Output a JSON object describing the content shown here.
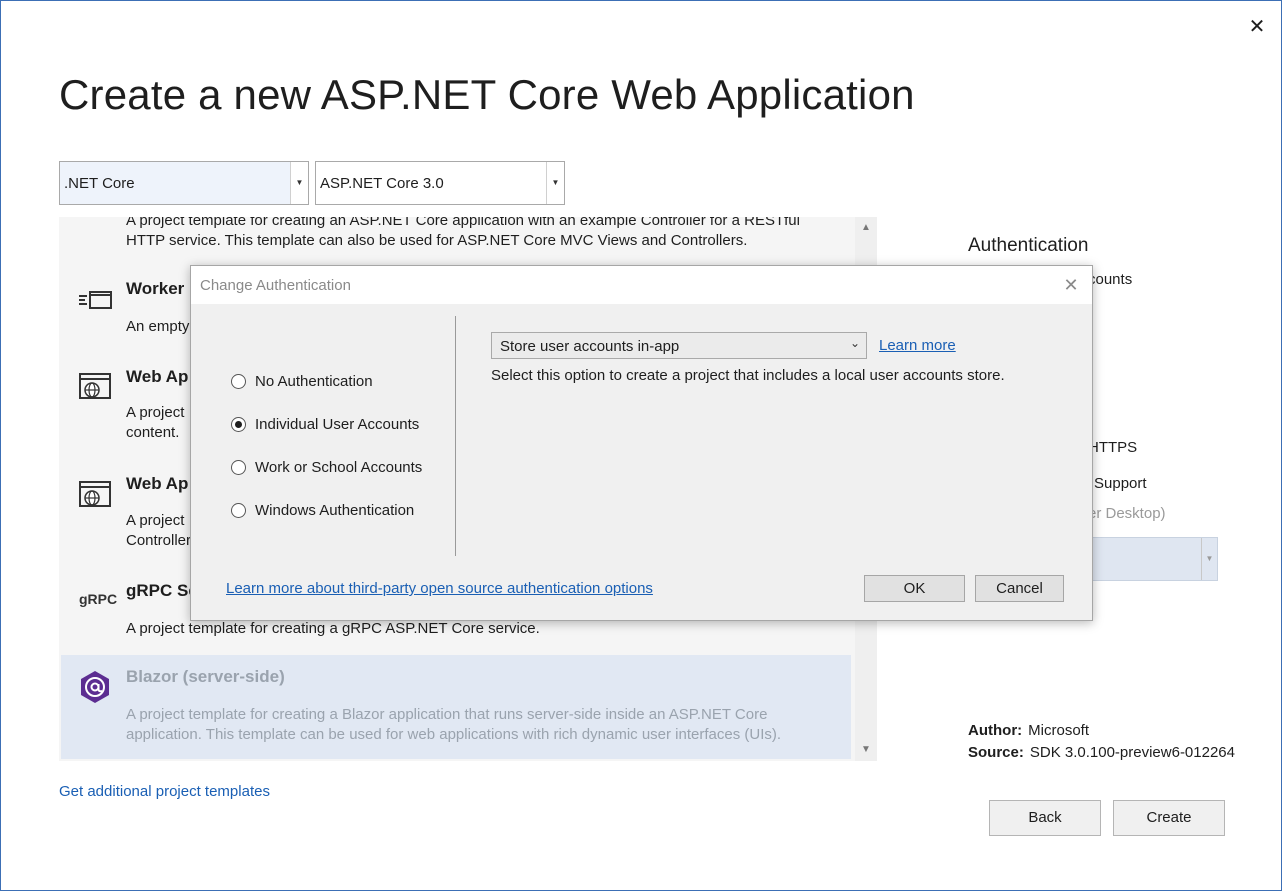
{
  "window": {
    "title": "Create a new ASP.NET Core Web Application",
    "close_glyph": "✕"
  },
  "filters": {
    "framework": ".NET Core",
    "version": "ASP.NET Core 3.0"
  },
  "templates": [
    {
      "name": "",
      "icon": "api-icon",
      "desc": "A project template for creating an ASP.NET Core application with an example Controller for a RESTful HTTP service. This template can also be used for ASP.NET Core MVC Views and Controllers."
    },
    {
      "name": "Worker",
      "icon": "worker-icon",
      "desc": "An empty"
    },
    {
      "name": "Web Ap",
      "icon": "web-app-icon",
      "desc": "A project\ncontent."
    },
    {
      "name": "Web Ap",
      "icon": "web-app-mvc-icon",
      "desc": "A project\nController"
    },
    {
      "name": "gRPC Se",
      "icon": "grpc-icon",
      "icon_text": "gRPC",
      "desc": "A project template for creating a gRPC ASP.NET Core service."
    },
    {
      "name": "Blazor (server-side)",
      "icon": "blazor-icon",
      "desc": "A project template for creating a Blazor application that runs server-side inside an ASP.NET Core application. This template can be used for web applications with rich dynamic user interfaces (UIs).",
      "selected": true
    }
  ],
  "get_more_link": "Get additional project templates",
  "right_panel": {
    "auth_heading": "Authentication",
    "auth_value_fragment": "counts",
    "https_fragment": "HTTPS",
    "support_fragment": "Support",
    "docker_fragment": "er Desktop)",
    "author_label": "Author:",
    "author_value": "Microsoft",
    "source_label": "Source:",
    "source_value": "SDK 3.0.100-preview6-012264"
  },
  "footer_buttons": {
    "back": "Back",
    "create": "Create"
  },
  "dialog": {
    "title": "Change Authentication",
    "close_glyph": "✕",
    "options": [
      {
        "label": "No Authentication",
        "selected": false
      },
      {
        "label": "Individual User Accounts",
        "selected": true
      },
      {
        "label": "Work or School Accounts",
        "selected": false
      },
      {
        "label": "Windows Authentication",
        "selected": false
      }
    ],
    "store_select": "Store user accounts in-app",
    "learn_more": "Learn more",
    "option_description": "Select this option to create a project that includes a local user accounts store.",
    "third_party_link": "Learn more about third-party open source authentication options",
    "ok": "OK",
    "cancel": "Cancel"
  },
  "colors": {
    "accent_link": "#1a5fb4",
    "selected_row": "#e1e8f3",
    "blazor_purple": "#5c2d91"
  }
}
